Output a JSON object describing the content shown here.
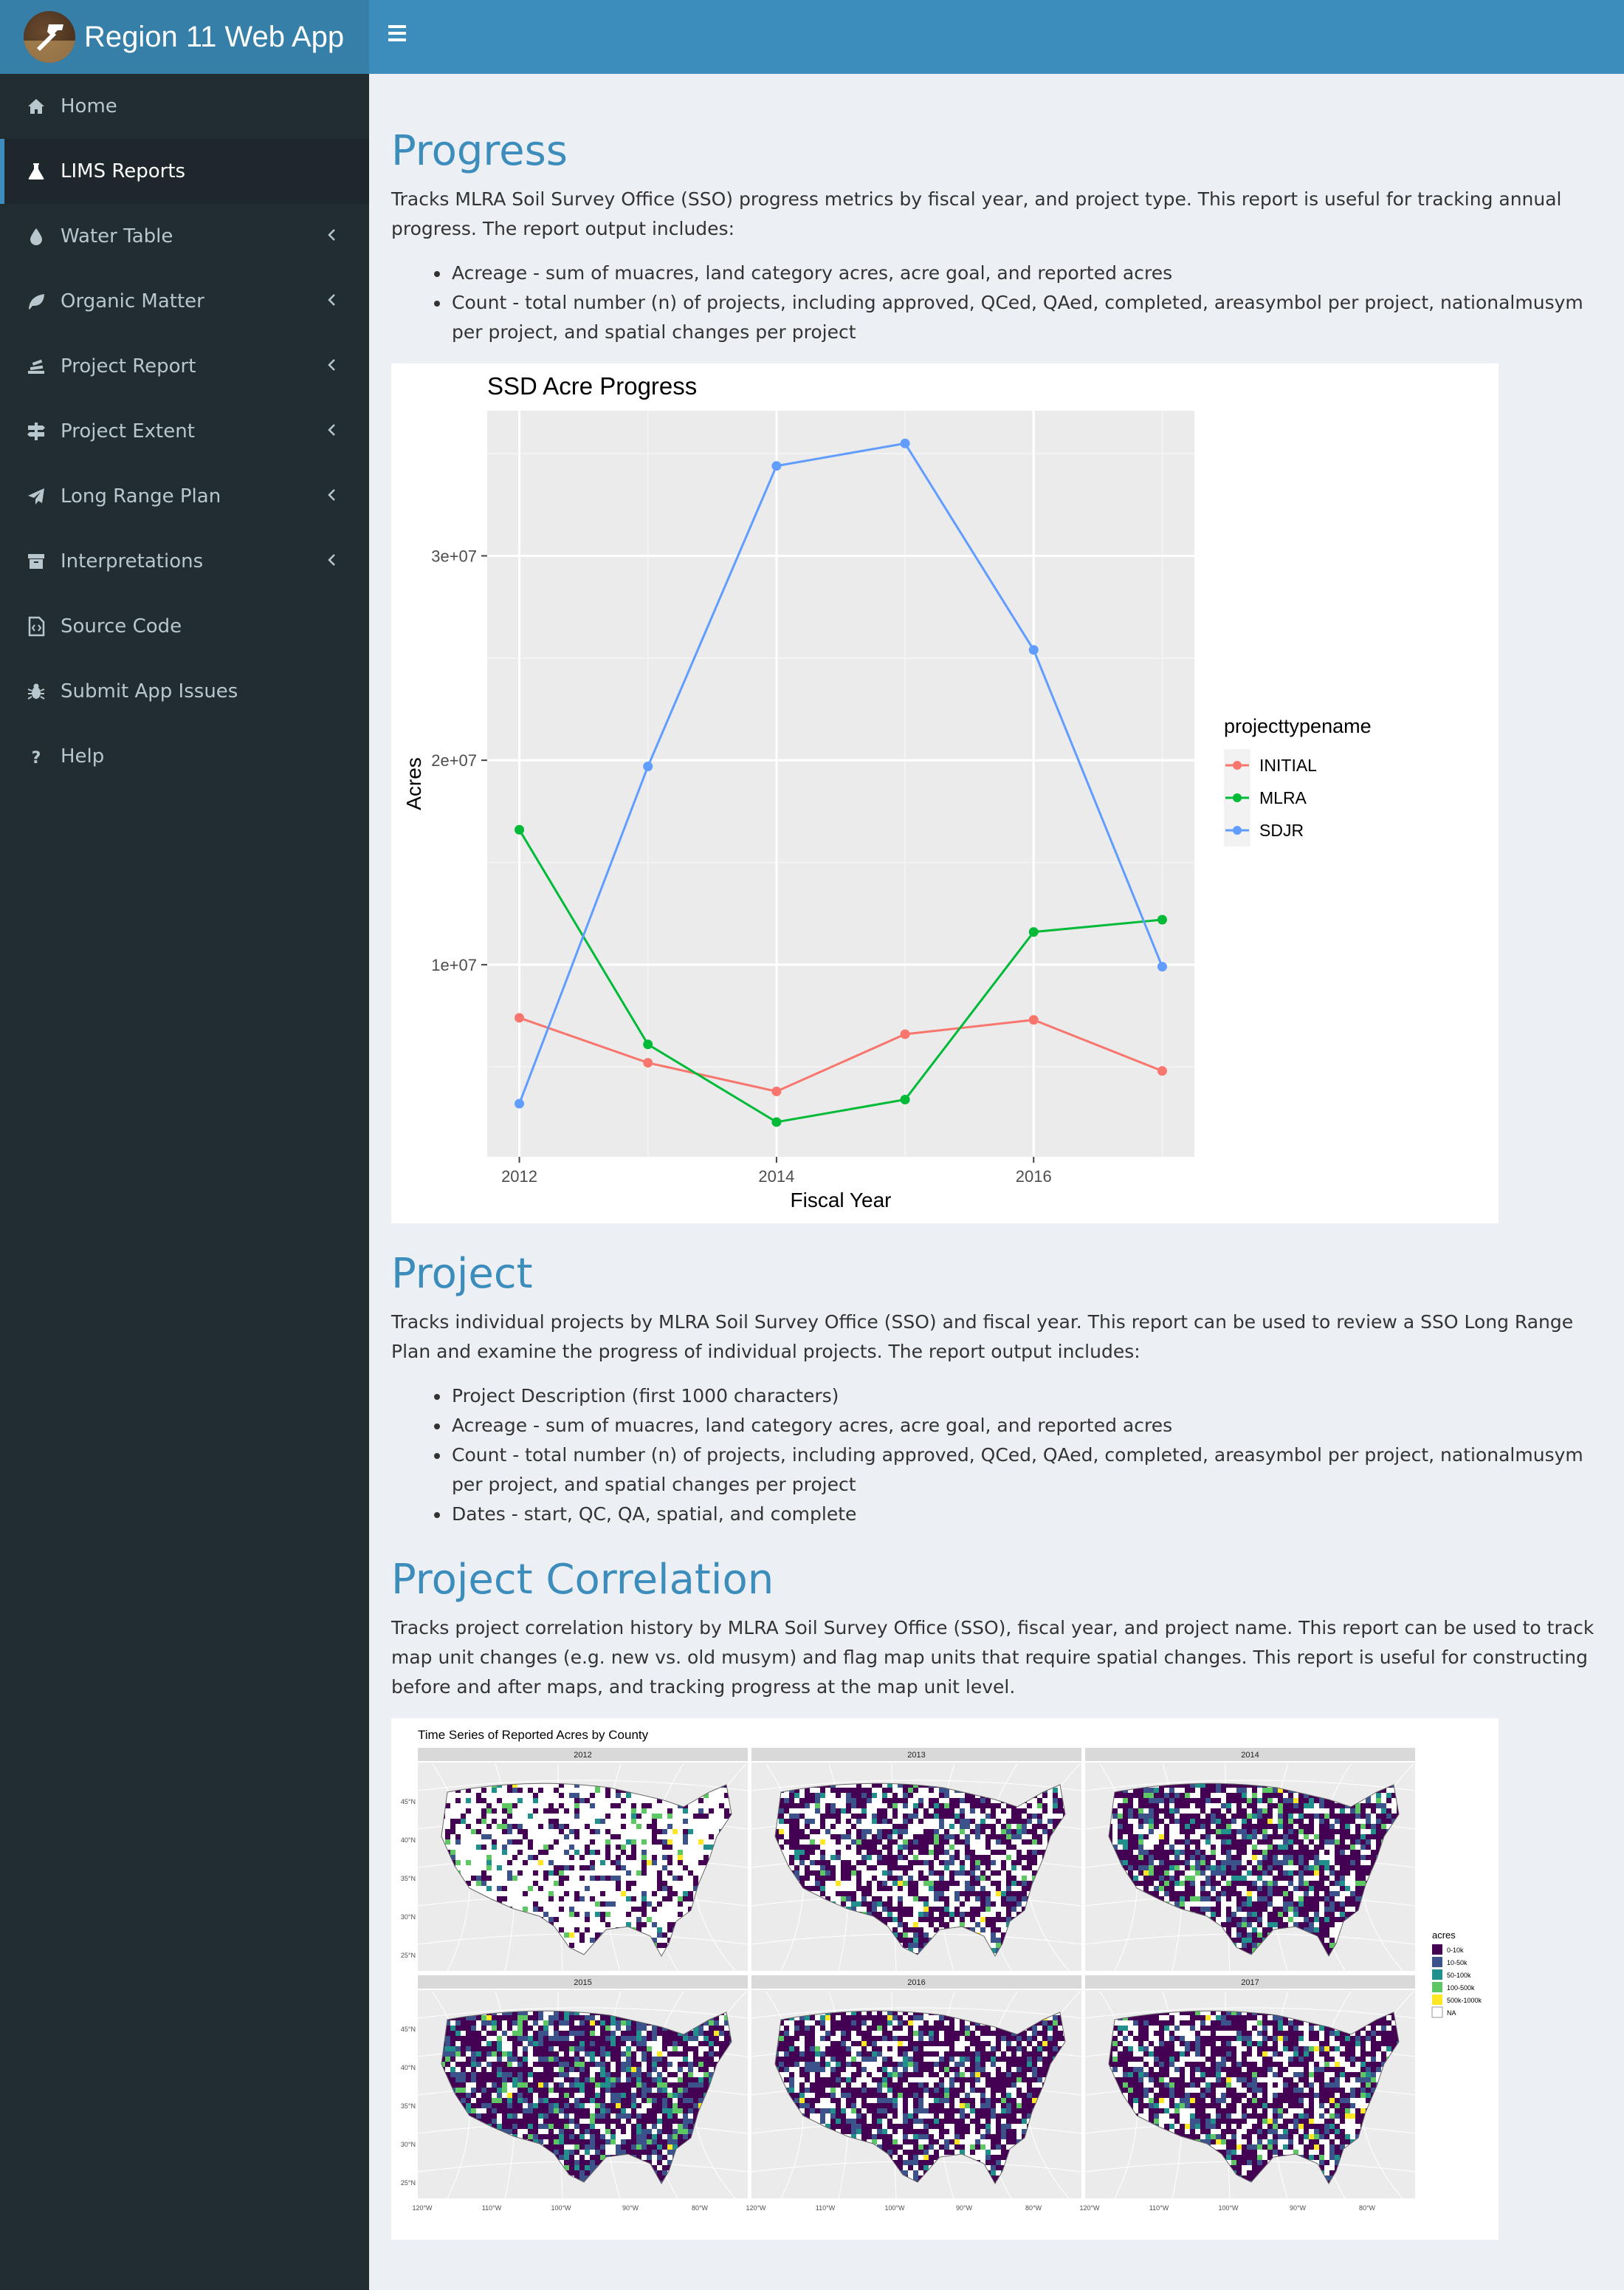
{
  "app": {
    "title": "Region 11 Web App"
  },
  "sidebar": {
    "items": [
      {
        "label": "Home",
        "icon": "home-icon",
        "chevron": false,
        "active": false
      },
      {
        "label": "LIMS Reports",
        "icon": "flask-icon",
        "chevron": false,
        "active": true
      },
      {
        "label": "Water Table",
        "icon": "tint-icon",
        "chevron": true,
        "active": false
      },
      {
        "label": "Organic Matter",
        "icon": "leaf-icon",
        "chevron": true,
        "active": false
      },
      {
        "label": "Project Report",
        "icon": "stack-icon",
        "chevron": true,
        "active": false
      },
      {
        "label": "Project Extent",
        "icon": "signs-icon",
        "chevron": true,
        "active": false
      },
      {
        "label": "Long Range Plan",
        "icon": "plane-icon",
        "chevron": true,
        "active": false
      },
      {
        "label": "Interpretations",
        "icon": "archive-icon",
        "chevron": true,
        "active": false
      },
      {
        "label": "Source Code",
        "icon": "code-file-icon",
        "chevron": false,
        "active": false
      },
      {
        "label": "Submit App Issues",
        "icon": "bug-icon",
        "chevron": false,
        "active": false
      },
      {
        "label": "Help",
        "icon": "question-icon",
        "chevron": false,
        "active": false
      }
    ]
  },
  "sections": {
    "progress": {
      "title": "Progress",
      "desc": "Tracks MLRA Soil Survey Office (SSO) progress metrics by fiscal year, and project type. This report is useful for tracking annual progress. The report output includes:",
      "bullets": [
        "Acreage - sum of muacres, land category acres, acre goal, and reported acres",
        "Count - total number (n) of projects, including approved, QCed, QAed, completed, areasymbol per project, nationalmusym per project, and spatial changes per project"
      ]
    },
    "project": {
      "title": "Project",
      "desc": "Tracks individual projects by MLRA Soil Survey Office (SSO) and fiscal year. This report can be used to review a SSO Long Range Plan and examine the progress of individual projects. The report output includes:",
      "bullets": [
        "Project Description (first 1000 characters)",
        "Acreage - sum of muacres, land category acres, acre goal, and reported acres",
        "Count - total number (n) of projects, including approved, QCed, QAed, completed, areasymbol per project, nationalmusym per project, and spatial changes per project",
        "Dates - start, QC, QA, spatial, and complete"
      ]
    },
    "correlation": {
      "title": "Project Correlation",
      "desc": "Tracks project correlation history by MLRA Soil Survey Office (SSO), fiscal year, and project name. This report can be used to track map unit changes (e.g. new vs. old musym) and flag map units that require spatial changes. This report is useful for constructing before and after maps, and tracking progress at the map unit level."
    }
  },
  "chart_data": {
    "type": "line",
    "title": "SSD Acre Progress",
    "xlabel": "Fiscal Year",
    "ylabel": "Acres",
    "x": [
      2012,
      2013,
      2014,
      2015,
      2016,
      2017
    ],
    "xticks": [
      2012,
      2014,
      2016
    ],
    "yticks": [
      10000000,
      20000000,
      30000000
    ],
    "ytick_labels": [
      "1e+07",
      "2e+07",
      "3e+07"
    ],
    "xlim": [
      2011.75,
      2017.25
    ],
    "ylim": [
      600000,
      37100000
    ],
    "legend_title": "projecttypename",
    "legend_position": "right",
    "grid": true,
    "series": [
      {
        "name": "INITIAL",
        "color": "#F8766D",
        "values": [
          7400000,
          5200000,
          3800000,
          6600000,
          7300000,
          4800000
        ]
      },
      {
        "name": "MLRA",
        "color": "#00BA38",
        "values": [
          16600000,
          6100000,
          2300000,
          3400000,
          11600000,
          12200000
        ]
      },
      {
        "name": "SDJR",
        "color": "#619CFF",
        "values": [
          3200000,
          19700000,
          34400000,
          35500000,
          25400000,
          9900000
        ]
      }
    ]
  },
  "map_figure": {
    "title": "Time Series of Reported Acres by County",
    "panels": [
      "2012",
      "2013",
      "2014",
      "2015",
      "2016",
      "2017"
    ],
    "lat_labels": [
      "45°N",
      "40°N",
      "35°N",
      "30°N",
      "25°N"
    ],
    "lon_labels": [
      "120°W",
      "110°W",
      "100°W",
      "90°W",
      "80°W"
    ],
    "legend_title": "acres",
    "legend": [
      {
        "label": "0-10k",
        "color": "#440154"
      },
      {
        "label": "10-50k",
        "color": "#3B528B"
      },
      {
        "label": "50-100k",
        "color": "#21908C"
      },
      {
        "label": "100-500k",
        "color": "#5DC863"
      },
      {
        "label": "500k-1000k",
        "color": "#FDE725"
      },
      {
        "label": "NA",
        "color": "#FFFFFF"
      }
    ]
  }
}
